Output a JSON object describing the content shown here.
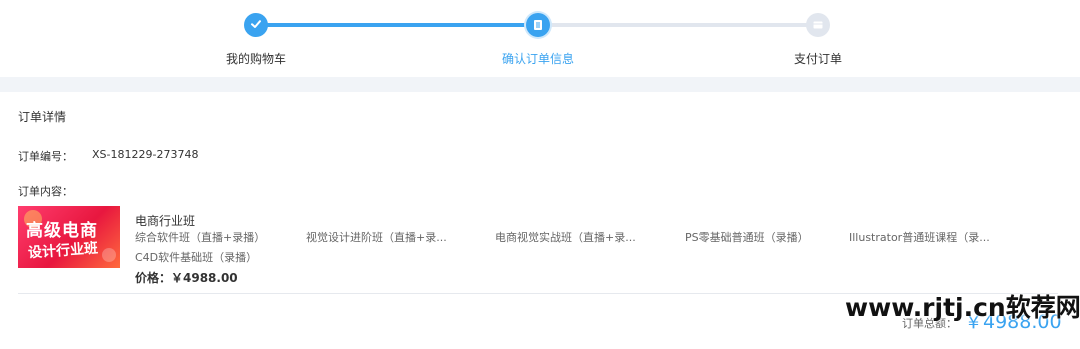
{
  "steps": [
    {
      "label": "我的购物车",
      "status": "done"
    },
    {
      "label": "确认订单信息",
      "status": "active"
    },
    {
      "label": "支付订单",
      "status": "todo"
    }
  ],
  "details": {
    "title": "订单详情",
    "order_no_label": "订单编号：",
    "order_no": "XS-181229-273748",
    "content_label": "订单内容：",
    "thumbnail": {
      "line1": "高级电商",
      "line2": "设计行业班"
    },
    "product": {
      "name": "电商行业班",
      "courses": [
        "综合软件班（直播+录播）",
        "视觉设计进阶班（直播+录...",
        "电商视觉实战班（直播+录...",
        "PS零基础普通班（录播）",
        "Illustrator普通班课程（录..."
      ],
      "courses_line2": "C4D软件基础班（录播）",
      "price": "价格：￥4988.00"
    },
    "total_label": "订单总额：",
    "total_value": "￥4988.00"
  },
  "watermark": "www.rjtj.cn软荐网",
  "colors": {
    "accent": "#3aa3f0",
    "inactive": "#e1e6ee",
    "background_gap": "#f1f4f8"
  },
  "icons": [
    "check-icon",
    "document-icon",
    "payment-icon"
  ]
}
